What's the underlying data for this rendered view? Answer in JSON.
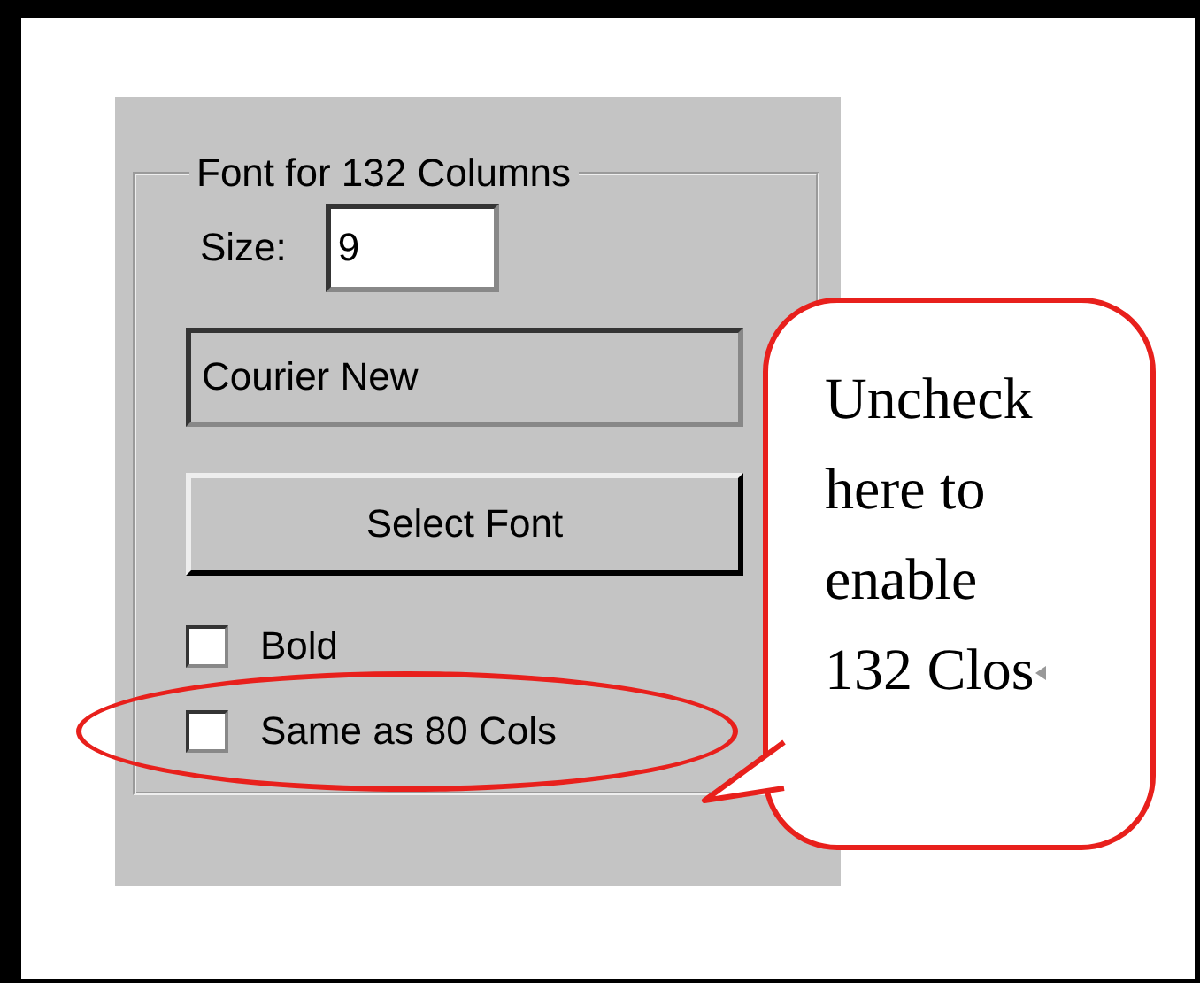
{
  "group_box": {
    "title": "Font for 132 Columns"
  },
  "size": {
    "label": "Size:",
    "value": "9"
  },
  "font_field": {
    "value": "Courier New"
  },
  "select_button": {
    "label": "Select Font"
  },
  "checkboxes": [
    {
      "label": "Bold",
      "checked": false,
      "highlighted": false
    },
    {
      "label": "Same as 80 Cols",
      "checked": false,
      "highlighted": true
    }
  ],
  "callout": {
    "lines": [
      "Uncheck",
      "here to",
      "enable",
      "132 Clos"
    ]
  }
}
